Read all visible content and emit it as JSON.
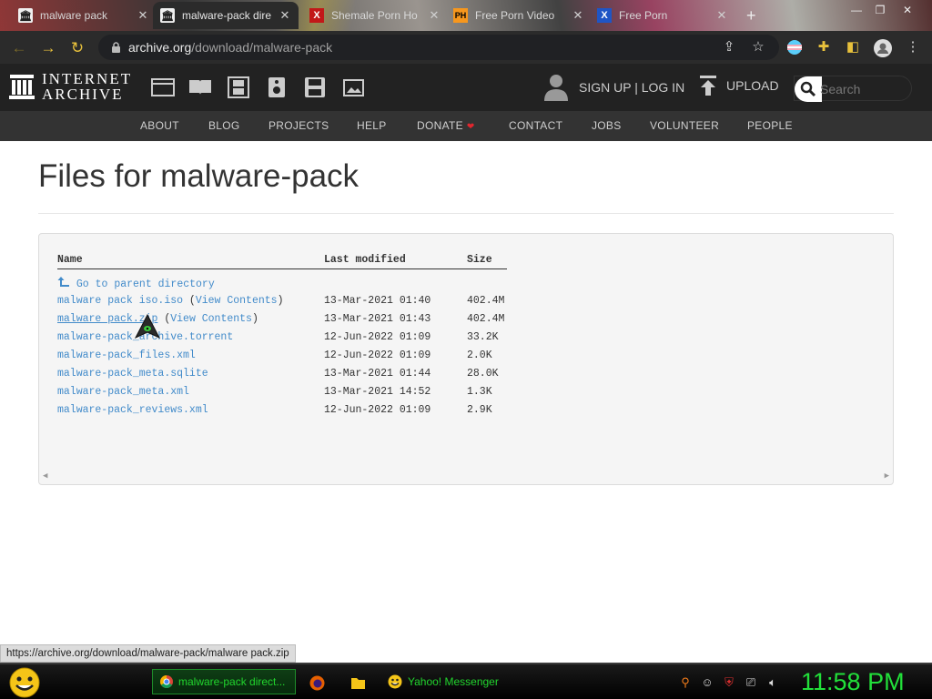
{
  "browser": {
    "tabs": [
      {
        "title": "malware pack",
        "favicon": "internet-archive-icon"
      },
      {
        "title": "malware-pack directory",
        "favicon": "internet-archive-icon"
      },
      {
        "title": "Shemale Porn Ho",
        "favicon": "xhamster-icon"
      },
      {
        "title": "Free Porn Video",
        "favicon": "pornhub-icon"
      },
      {
        "title": "Free Porn",
        "favicon": "xbox-x-icon"
      }
    ],
    "new_tab_label": "+",
    "url_domain": "archive.org",
    "url_path": "/download/malware-pack"
  },
  "ia": {
    "logo_line1": "INTERNET",
    "logo_line2": "ARCHIVE",
    "signup_text": "SIGN UP | LOG IN",
    "upload_text": "UPLOAD",
    "search_placeholder": "Search",
    "nav": [
      "ABOUT",
      "BLOG",
      "PROJECTS",
      "HELP",
      "DONATE",
      "CONTACT",
      "JOBS",
      "VOLUNTEER",
      "PEOPLE"
    ],
    "colors": {
      "header": "#222222",
      "nav": "#333333",
      "link": "#428bca",
      "donate_heart": "#e2262e"
    }
  },
  "page": {
    "title": "Files for malware-pack",
    "headers": {
      "name": "Name",
      "modified": "Last modified",
      "size": "Size"
    },
    "parent_link": "Go to parent directory",
    "files": [
      {
        "name": "malware pack iso.iso",
        "view_contents": "View Contents",
        "modified": "13-Mar-2021 01:40",
        "size": "402.4M"
      },
      {
        "name": "malware pack.zip",
        "view_contents": "View Contents",
        "modified": "13-Mar-2021 01:43",
        "size": "402.4M"
      },
      {
        "name": "malware-pack_archive.torrent",
        "view_contents": "",
        "modified": "12-Jun-2022 01:09",
        "size": "33.2K"
      },
      {
        "name": "malware-pack_files.xml",
        "view_contents": "",
        "modified": "12-Jun-2022 01:09",
        "size": "2.0K"
      },
      {
        "name": "malware-pack_meta.sqlite",
        "view_contents": "",
        "modified": "13-Mar-2021 01:44",
        "size": "28.0K"
      },
      {
        "name": "malware-pack_meta.xml",
        "view_contents": "",
        "modified": "13-Mar-2021 14:52",
        "size": "1.3K"
      },
      {
        "name": "malware-pack_reviews.xml",
        "view_contents": "",
        "modified": "12-Jun-2022 01:09",
        "size": "2.9K"
      }
    ]
  },
  "status_url": "https://archive.org/download/malware-pack/malware pack.zip",
  "taskbar": {
    "buttons": [
      {
        "label": "malware-pack direct...",
        "icon": "chrome-icon"
      },
      {
        "label": "Yahoo! Messenger",
        "icon": "yahoo-messenger-icon"
      }
    ],
    "clock": "11:58 PM",
    "accent": "#22e03a"
  }
}
